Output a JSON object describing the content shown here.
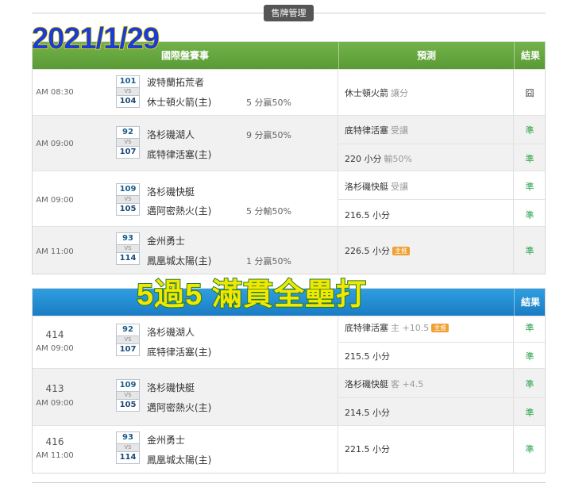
{
  "toolbar": {
    "tab_label": "售牌管理"
  },
  "stamp": {
    "date": "2021/1/29"
  },
  "overlay": {
    "text": "5過5 滿貫全壘打"
  },
  "table1": {
    "headers": {
      "match": "國際盤賽事",
      "prediction": "預測",
      "result": "結果"
    },
    "rows": [
      {
        "time": "AM 08:30",
        "away_no": "101",
        "away": "波特蘭拓荒者",
        "home_no": "104",
        "home": "休士頓火箭(主)",
        "odds": "5 分贏50%",
        "preds": [
          {
            "text": "休士頓火箭",
            "sub": "讓分",
            "badge": "",
            "result": "囧",
            "outcome": "miss"
          }
        ]
      },
      {
        "time": "AM 09:00",
        "away_no": "92",
        "away": "洛杉磯湖人",
        "home_no": "107",
        "home": "底特律活塞(主)",
        "odds": "9 分贏50%",
        "preds": [
          {
            "text": "底特律活塞",
            "sub": "受讓",
            "badge": "",
            "result": "準",
            "outcome": "hit"
          },
          {
            "text": "220 小分",
            "sub": "輸50%",
            "badge": "",
            "result": "準",
            "outcome": "hit"
          }
        ]
      },
      {
        "time": "AM 09:00",
        "away_no": "109",
        "away": "洛杉磯快艇",
        "home_no": "105",
        "home": "邁阿密熱火(主)",
        "odds": "5 分輸50%",
        "preds": [
          {
            "text": "洛杉磯快艇",
            "sub": "受讓",
            "badge": "",
            "result": "準",
            "outcome": "hit"
          },
          {
            "text": "216.5 小分",
            "sub": "",
            "badge": "",
            "result": "準",
            "outcome": "hit"
          }
        ]
      },
      {
        "time": "AM 11:00",
        "away_no": "93",
        "away": "金州勇士",
        "home_no": "114",
        "home": "鳳凰城太陽(主)",
        "odds": "1 分贏50%",
        "preds": [
          {
            "text": "226.5 小分",
            "sub": "",
            "badge": "主推",
            "result": "準",
            "outcome": "hit"
          }
        ]
      }
    ]
  },
  "table2": {
    "headers": {
      "result": "結果"
    },
    "rows": [
      {
        "index": "414",
        "time": "AM 09:00",
        "away_no": "92",
        "away": "洛杉磯湖人",
        "home_no": "107",
        "home": "底特律活塞(主)",
        "preds": [
          {
            "text": "底特律活塞",
            "sub": "主 +10.5",
            "badge": "主推",
            "result": "準",
            "outcome": "hit"
          },
          {
            "text": "215.5 小分",
            "sub": "",
            "badge": "",
            "result": "準",
            "outcome": "hit"
          }
        ]
      },
      {
        "index": "413",
        "time": "AM 09:00",
        "away_no": "109",
        "away": "洛杉磯快艇",
        "home_no": "105",
        "home": "邁阿密熱火(主)",
        "preds": [
          {
            "text": "洛杉磯快艇",
            "sub": "客 +4.5",
            "badge": "",
            "result": "準",
            "outcome": "hit"
          },
          {
            "text": "214.5 小分",
            "sub": "",
            "badge": "",
            "result": "準",
            "outcome": "hit"
          }
        ]
      },
      {
        "index": "416",
        "time": "AM 11:00",
        "away_no": "93",
        "away": "金州勇士",
        "home_no": "114",
        "home": "鳳凰城太陽(主)",
        "preds": [
          {
            "text": "221.5 小分",
            "sub": "",
            "badge": "",
            "result": "準",
            "outcome": "hit"
          }
        ]
      }
    ]
  }
}
